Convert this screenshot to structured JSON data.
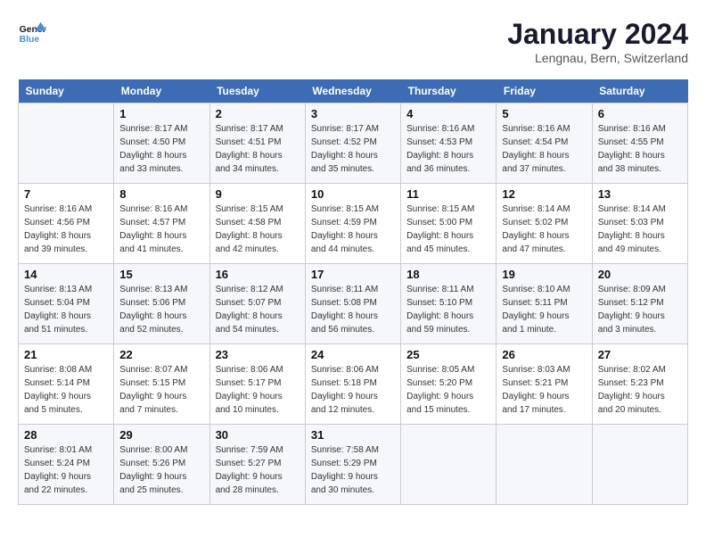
{
  "header": {
    "logo_line1": "General",
    "logo_line2": "Blue",
    "month_title": "January 2024",
    "location": "Lengnau, Bern, Switzerland"
  },
  "days_of_week": [
    "Sunday",
    "Monday",
    "Tuesday",
    "Wednesday",
    "Thursday",
    "Friday",
    "Saturday"
  ],
  "weeks": [
    [
      {
        "day": "",
        "sunrise": "",
        "sunset": "",
        "daylight": ""
      },
      {
        "day": "1",
        "sunrise": "Sunrise: 8:17 AM",
        "sunset": "Sunset: 4:50 PM",
        "daylight": "Daylight: 8 hours and 33 minutes."
      },
      {
        "day": "2",
        "sunrise": "Sunrise: 8:17 AM",
        "sunset": "Sunset: 4:51 PM",
        "daylight": "Daylight: 8 hours and 34 minutes."
      },
      {
        "day": "3",
        "sunrise": "Sunrise: 8:17 AM",
        "sunset": "Sunset: 4:52 PM",
        "daylight": "Daylight: 8 hours and 35 minutes."
      },
      {
        "day": "4",
        "sunrise": "Sunrise: 8:16 AM",
        "sunset": "Sunset: 4:53 PM",
        "daylight": "Daylight: 8 hours and 36 minutes."
      },
      {
        "day": "5",
        "sunrise": "Sunrise: 8:16 AM",
        "sunset": "Sunset: 4:54 PM",
        "daylight": "Daylight: 8 hours and 37 minutes."
      },
      {
        "day": "6",
        "sunrise": "Sunrise: 8:16 AM",
        "sunset": "Sunset: 4:55 PM",
        "daylight": "Daylight: 8 hours and 38 minutes."
      }
    ],
    [
      {
        "day": "7",
        "sunrise": "Sunrise: 8:16 AM",
        "sunset": "Sunset: 4:56 PM",
        "daylight": "Daylight: 8 hours and 39 minutes."
      },
      {
        "day": "8",
        "sunrise": "Sunrise: 8:16 AM",
        "sunset": "Sunset: 4:57 PM",
        "daylight": "Daylight: 8 hours and 41 minutes."
      },
      {
        "day": "9",
        "sunrise": "Sunrise: 8:15 AM",
        "sunset": "Sunset: 4:58 PM",
        "daylight": "Daylight: 8 hours and 42 minutes."
      },
      {
        "day": "10",
        "sunrise": "Sunrise: 8:15 AM",
        "sunset": "Sunset: 4:59 PM",
        "daylight": "Daylight: 8 hours and 44 minutes."
      },
      {
        "day": "11",
        "sunrise": "Sunrise: 8:15 AM",
        "sunset": "Sunset: 5:00 PM",
        "daylight": "Daylight: 8 hours and 45 minutes."
      },
      {
        "day": "12",
        "sunrise": "Sunrise: 8:14 AM",
        "sunset": "Sunset: 5:02 PM",
        "daylight": "Daylight: 8 hours and 47 minutes."
      },
      {
        "day": "13",
        "sunrise": "Sunrise: 8:14 AM",
        "sunset": "Sunset: 5:03 PM",
        "daylight": "Daylight: 8 hours and 49 minutes."
      }
    ],
    [
      {
        "day": "14",
        "sunrise": "Sunrise: 8:13 AM",
        "sunset": "Sunset: 5:04 PM",
        "daylight": "Daylight: 8 hours and 51 minutes."
      },
      {
        "day": "15",
        "sunrise": "Sunrise: 8:13 AM",
        "sunset": "Sunset: 5:06 PM",
        "daylight": "Daylight: 8 hours and 52 minutes."
      },
      {
        "day": "16",
        "sunrise": "Sunrise: 8:12 AM",
        "sunset": "Sunset: 5:07 PM",
        "daylight": "Daylight: 8 hours and 54 minutes."
      },
      {
        "day": "17",
        "sunrise": "Sunrise: 8:11 AM",
        "sunset": "Sunset: 5:08 PM",
        "daylight": "Daylight: 8 hours and 56 minutes."
      },
      {
        "day": "18",
        "sunrise": "Sunrise: 8:11 AM",
        "sunset": "Sunset: 5:10 PM",
        "daylight": "Daylight: 8 hours and 59 minutes."
      },
      {
        "day": "19",
        "sunrise": "Sunrise: 8:10 AM",
        "sunset": "Sunset: 5:11 PM",
        "daylight": "Daylight: 9 hours and 1 minute."
      },
      {
        "day": "20",
        "sunrise": "Sunrise: 8:09 AM",
        "sunset": "Sunset: 5:12 PM",
        "daylight": "Daylight: 9 hours and 3 minutes."
      }
    ],
    [
      {
        "day": "21",
        "sunrise": "Sunrise: 8:08 AM",
        "sunset": "Sunset: 5:14 PM",
        "daylight": "Daylight: 9 hours and 5 minutes."
      },
      {
        "day": "22",
        "sunrise": "Sunrise: 8:07 AM",
        "sunset": "Sunset: 5:15 PM",
        "daylight": "Daylight: 9 hours and 7 minutes."
      },
      {
        "day": "23",
        "sunrise": "Sunrise: 8:06 AM",
        "sunset": "Sunset: 5:17 PM",
        "daylight": "Daylight: 9 hours and 10 minutes."
      },
      {
        "day": "24",
        "sunrise": "Sunrise: 8:06 AM",
        "sunset": "Sunset: 5:18 PM",
        "daylight": "Daylight: 9 hours and 12 minutes."
      },
      {
        "day": "25",
        "sunrise": "Sunrise: 8:05 AM",
        "sunset": "Sunset: 5:20 PM",
        "daylight": "Daylight: 9 hours and 15 minutes."
      },
      {
        "day": "26",
        "sunrise": "Sunrise: 8:03 AM",
        "sunset": "Sunset: 5:21 PM",
        "daylight": "Daylight: 9 hours and 17 minutes."
      },
      {
        "day": "27",
        "sunrise": "Sunrise: 8:02 AM",
        "sunset": "Sunset: 5:23 PM",
        "daylight": "Daylight: 9 hours and 20 minutes."
      }
    ],
    [
      {
        "day": "28",
        "sunrise": "Sunrise: 8:01 AM",
        "sunset": "Sunset: 5:24 PM",
        "daylight": "Daylight: 9 hours and 22 minutes."
      },
      {
        "day": "29",
        "sunrise": "Sunrise: 8:00 AM",
        "sunset": "Sunset: 5:26 PM",
        "daylight": "Daylight: 9 hours and 25 minutes."
      },
      {
        "day": "30",
        "sunrise": "Sunrise: 7:59 AM",
        "sunset": "Sunset: 5:27 PM",
        "daylight": "Daylight: 9 hours and 28 minutes."
      },
      {
        "day": "31",
        "sunrise": "Sunrise: 7:58 AM",
        "sunset": "Sunset: 5:29 PM",
        "daylight": "Daylight: 9 hours and 30 minutes."
      },
      {
        "day": "",
        "sunrise": "",
        "sunset": "",
        "daylight": ""
      },
      {
        "day": "",
        "sunrise": "",
        "sunset": "",
        "daylight": ""
      },
      {
        "day": "",
        "sunrise": "",
        "sunset": "",
        "daylight": ""
      }
    ]
  ]
}
